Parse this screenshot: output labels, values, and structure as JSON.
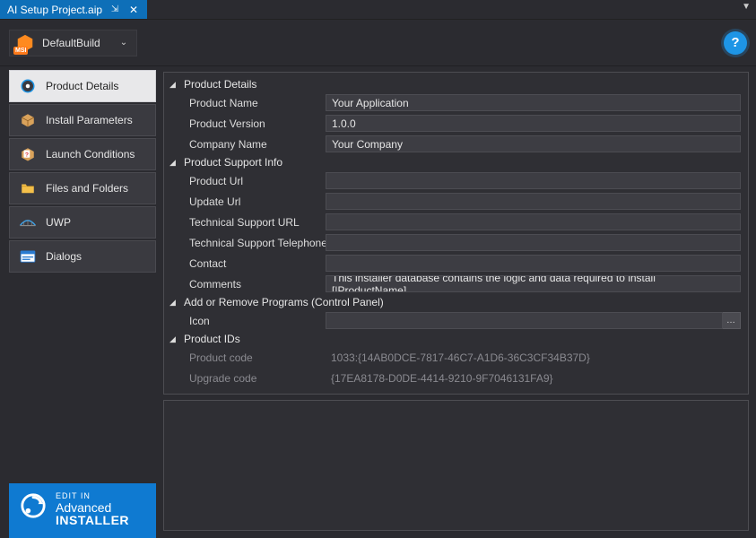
{
  "tab": {
    "title": "AI Setup Project.aip"
  },
  "toolbar": {
    "build_label": "DefaultBuild"
  },
  "sidebar": {
    "items": [
      {
        "label": "Product Details"
      },
      {
        "label": "Install Parameters"
      },
      {
        "label": "Launch Conditions"
      },
      {
        "label": "Files and Folders"
      },
      {
        "label": "UWP"
      },
      {
        "label": "Dialogs"
      }
    ]
  },
  "branding": {
    "edit_in": "EDIT IN",
    "line1": "Advanced",
    "line2": "INSTALLER"
  },
  "sections": {
    "product_details": {
      "title": "Product Details",
      "fields": {
        "product_name": {
          "label": "Product Name",
          "value": "Your Application"
        },
        "product_version": {
          "label": "Product Version",
          "value": "1.0.0"
        },
        "company_name": {
          "label": "Company Name",
          "value": "Your Company"
        }
      }
    },
    "support_info": {
      "title": "Product Support Info",
      "fields": {
        "product_url": {
          "label": "Product Url",
          "value": ""
        },
        "update_url": {
          "label": "Update Url",
          "value": ""
        },
        "tech_url": {
          "label": "Technical Support URL",
          "value": ""
        },
        "tech_phone": {
          "label": "Technical Support Telephone",
          "value": ""
        },
        "contact": {
          "label": "Contact",
          "value": ""
        },
        "comments": {
          "label": "Comments",
          "value": "This installer database contains the logic and data required to install [|ProductName]."
        }
      }
    },
    "arp": {
      "title": "Add or Remove Programs (Control Panel)",
      "fields": {
        "icon": {
          "label": "Icon",
          "value": ""
        }
      }
    },
    "product_ids": {
      "title": "Product IDs",
      "fields": {
        "product_code": {
          "label": "Product code",
          "value": "1033:{14AB0DCE-7817-46C7-A1D6-36C3CF34B37D}"
        },
        "upgrade_code": {
          "label": "Upgrade code",
          "value": "{17EA8178-D0DE-4414-9210-9F7046131FA9}"
        }
      }
    }
  }
}
